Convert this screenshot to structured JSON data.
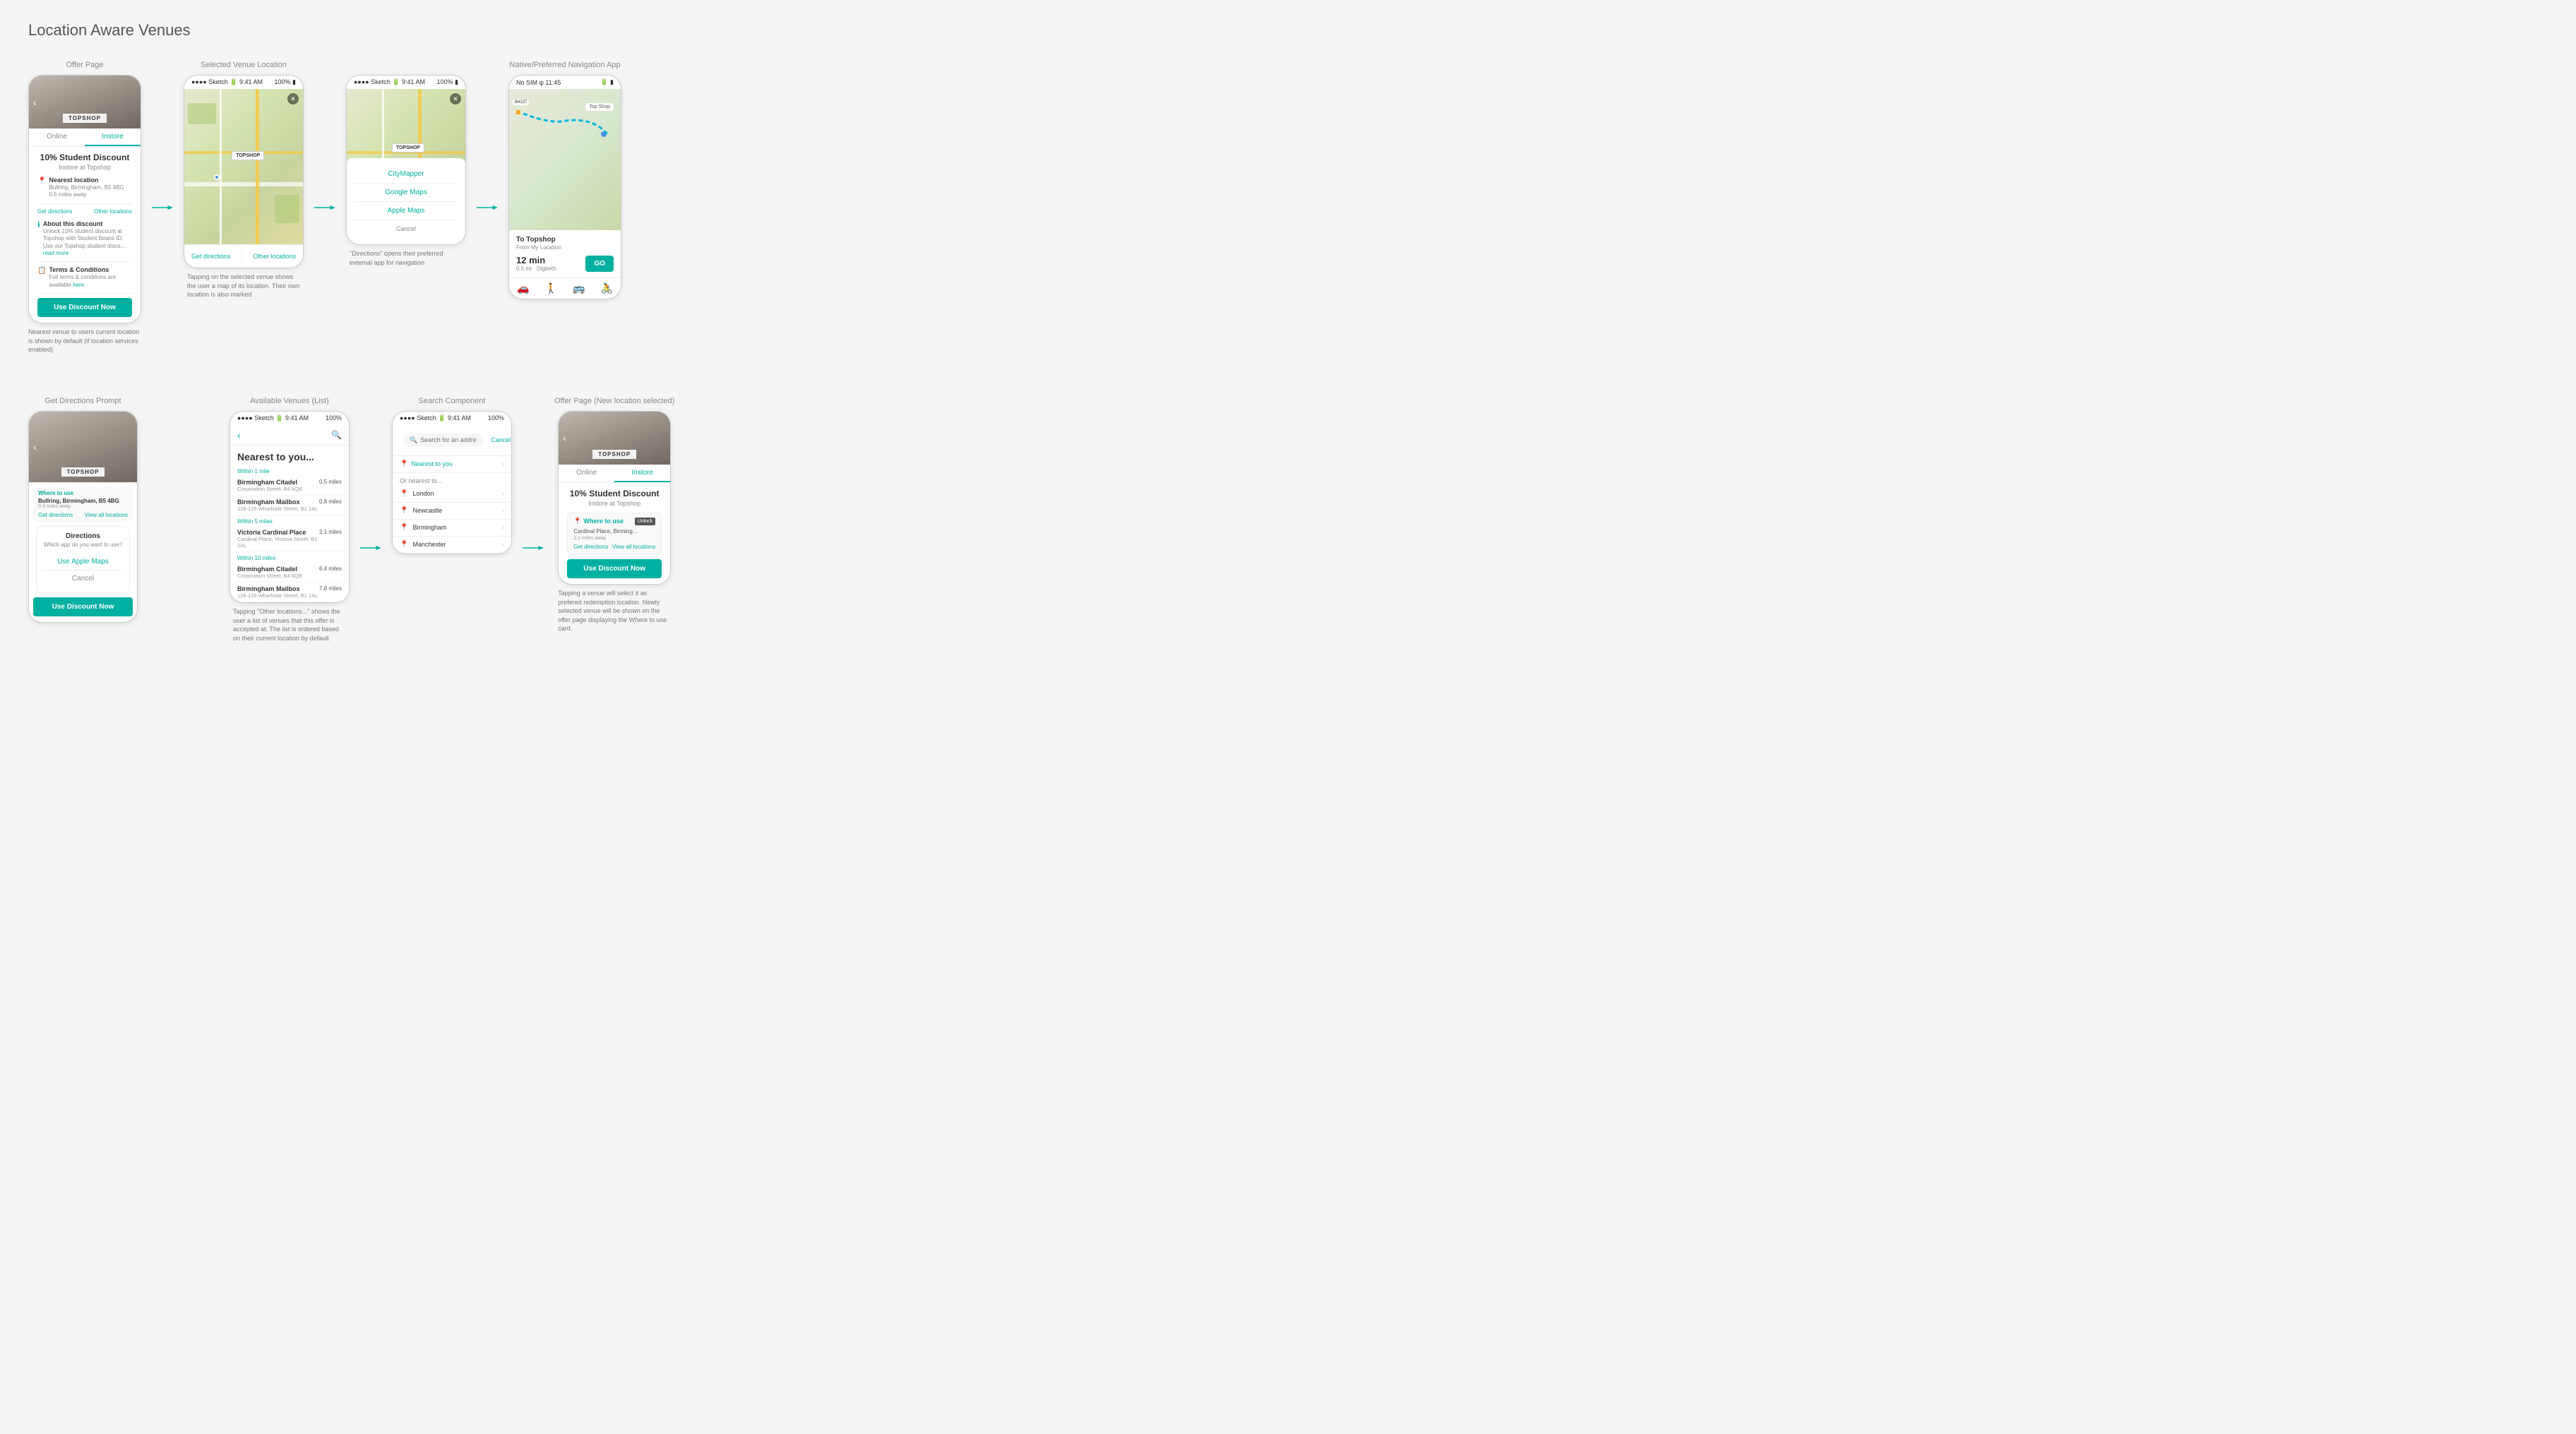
{
  "page": {
    "title": "Location Aware Venues"
  },
  "sections": {
    "offer_page": {
      "label": "Offer Page",
      "tabs": [
        "Online",
        "Instore"
      ],
      "active_tab": "Instore",
      "discount_title": "10% Student Discount",
      "discount_subtitle": "Instore at Topshop",
      "nearest_location_label": "Nearest location",
      "location_name": "Bullring, Birmingham, B5 4BG",
      "location_dist": "0.5 miles away",
      "get_directions": "Get directions",
      "other_locations": "Other locations",
      "about_label": "About this discount",
      "about_text": "Unlock 10% student discount at Topshop with Student Beans ID. Use our Topshop student disco...",
      "read_more": "read more",
      "terms_label": "Terms & Conditions",
      "terms_text": "Full terms & conditions are available",
      "terms_link": "here",
      "use_discount_btn": "Use Discount Now",
      "caption": "Nearest venue to users current location is shown by default (if location services enabled)"
    },
    "selected_venue": {
      "label": "Selected Venue Location",
      "topshop_pin": "TOPSHOP",
      "get_directions_btn": "Get directions",
      "other_locations_btn": "Other locations",
      "caption": "Tapping on the selected venue shows the user a map of its location. Their own location is also marked"
    },
    "directions_modal_map": {
      "citymapper": "CityMapper",
      "google_maps": "Google Maps",
      "apple_maps": "Apple Maps",
      "cancel": "Cancel",
      "caption": "\"Directions\" opens their preferred external app for navigation"
    },
    "native_nav": {
      "label": "Native/Preferred Navigation App",
      "to": "To Topshop",
      "from": "From My Location",
      "time": "12 min",
      "distance": "0.5 mi · Digbeth",
      "go_btn": "GO"
    },
    "get_directions_prompt": {
      "label": "Get Directions Prompt",
      "modal_title": "Directions",
      "modal_subtitle": "Which app do you want to use?",
      "use_apple_maps": "Use Apple Maps",
      "cancel": "Cancel",
      "where_to_use": "Where to use",
      "location": "Bullring, Birmingham, B5 4BG",
      "dist": "0.3 miles away",
      "get_directions": "Get directions",
      "view_all": "View all locations",
      "use_discount_btn": "Use Discount Now"
    },
    "available_venues": {
      "label": "Available Venues (List)",
      "title": "Nearest to you...",
      "group1": "Within 1 mile",
      "venues_1": [
        {
          "name": "Birmingham Citadel",
          "addr": "Corporation Street, B4 6QB",
          "dist": "0.5 miles"
        },
        {
          "name": "Birmingham Mailbox",
          "addr": "126-129 Wharfside Street, B1 1AL",
          "dist": "0.8 miles"
        }
      ],
      "group2": "Within 5 miles",
      "venues_2": [
        {
          "name": "Victoria Cardinal Place",
          "addr": "Cardinal Place, Victoria Street, B1 1AL",
          "dist": "2.1 miles"
        }
      ],
      "group3": "Within 10 miles",
      "venues_3": [
        {
          "name": "Birmingham Citadel",
          "addr": "Corporation Street, B4 6QB",
          "dist": "6.4 miles"
        },
        {
          "name": "Birmingham Mailbox",
          "addr": "126-129 Wharfside Street, B1 1AL",
          "dist": "7.8 miles"
        }
      ],
      "caption": "Tapping \"Other locations...\" shows the user a list of venues that this offer is accepted at. The list is ordered based on their current location by default"
    },
    "search_component": {
      "label": "Search Component",
      "search_placeholder": "Search for an address...",
      "cancel": "Cancel",
      "nearest_to_you": "Nearest to you",
      "or_nearest_to": "Or nearest to...",
      "cities": [
        "London",
        "Newcastle",
        "Birmingham",
        "Manchester"
      ]
    },
    "offer_page_new": {
      "label": "Offer Page (New location selected)",
      "tabs": [
        "Online",
        "Instore"
      ],
      "active_tab": "Instore",
      "discount_title": "10% Student Discount",
      "discount_subtitle": "Instore at Topshop",
      "where_to_use": "Where to use",
      "unlock_label": "Unlock",
      "location": "Cardinal Place, Birming...",
      "dist": "2.1 miles away",
      "get_directions": "Get directions",
      "view_all": "View all locations",
      "use_discount_btn": "Use Discount Now",
      "caption": "Tapping a venue will select it as prefered redemption location. Newly selected venue will be shown on the offer page displaying the Where to use card."
    }
  }
}
